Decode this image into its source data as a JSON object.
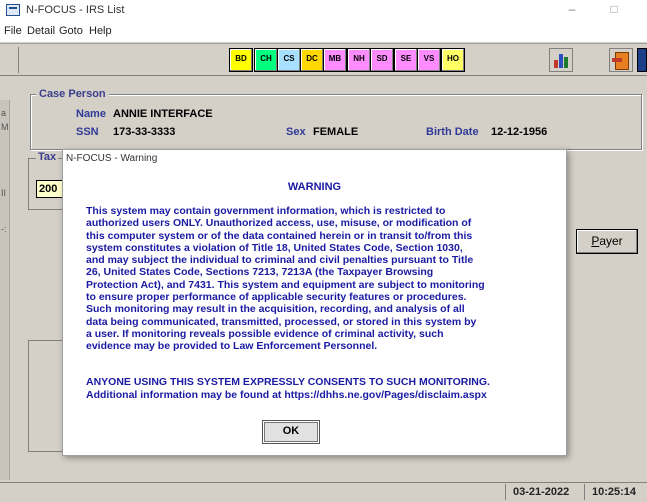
{
  "window": {
    "title": "N-FOCUS - IRS List",
    "minimize": "–",
    "maximize": "□"
  },
  "menu": [
    "File",
    "Detail",
    "Goto",
    "Help"
  ],
  "toolbar": {
    "buttons": [
      {
        "label": "BD",
        "color": "#ffff00"
      },
      {
        "label": "CH",
        "color": "#00ff7f"
      },
      {
        "label": "CS",
        "color": "#a8e0ff"
      },
      {
        "label": "DC",
        "color": "#ffd800"
      },
      {
        "label": "MB",
        "color": "#ff8cff"
      },
      {
        "label": "NH",
        "color": "#ff8cff"
      },
      {
        "label": "SD",
        "color": "#ff8cff"
      },
      {
        "label": "SE",
        "color": "#ff8cff"
      },
      {
        "label": "VS",
        "color": "#ff8cff"
      },
      {
        "label": "HO",
        "color": "#ffff66"
      }
    ],
    "chart_icon": "bar-chart-icon",
    "exit_icon": "exit-door-icon"
  },
  "case_person": {
    "legend": "Case Person",
    "name_label": "Name",
    "name_value": "ANNIE INTERFACE",
    "ssn_label": "SSN",
    "ssn_value": "173-33-3333",
    "sex_label": "Sex",
    "sex_value": "FEMALE",
    "birth_label": "Birth Date",
    "birth_value": "12-12-1956"
  },
  "tax": {
    "legend": "Tax",
    "year_value": "200"
  },
  "left_strip": {
    "chars": [
      "a",
      "M",
      "II",
      "-:"
    ]
  },
  "payer_button": {
    "label_first": "P",
    "label_rest": "ayer"
  },
  "status": {
    "date": "03-21-2022",
    "time": "10:25:14"
  },
  "dialog": {
    "title": "N-FOCUS - Warning",
    "heading": "WARNING",
    "body_lines": [
      "This system may contain government information, which is restricted to",
      "authorized users ONLY. Unauthorized access, use, misuse, or modification of",
      "this computer system or of the data contained herein or in transit to/from this",
      "system constitutes a violation of Title 18, United States Code, Section 1030,",
      "and may subject the individual to criminal and civil penalties pursuant to Title",
      "26, United States Code, Sections 7213, 7213A (the Taxpayer Browsing",
      "Protection Act), and 7431. This system and equipment are subject to monitoring",
      "to ensure proper performance of applicable security features or procedures.",
      "Such monitoring may result in the acquisition, recording, and analysis of all",
      "data being communicated, transmitted, processed, or stored in this system by",
      "a user. If monitoring reveals possible evidence of criminal activity, such",
      "evidence may be provided to Law Enforcement Personnel."
    ],
    "consent": "ANYONE USING THIS SYSTEM EXPRESSLY CONSENTS TO SUCH MONITORING.",
    "info": "Additional information may be found at https://dhhs.ne.gov/Pages/disclaim.aspx",
    "ok_label": "OK"
  }
}
